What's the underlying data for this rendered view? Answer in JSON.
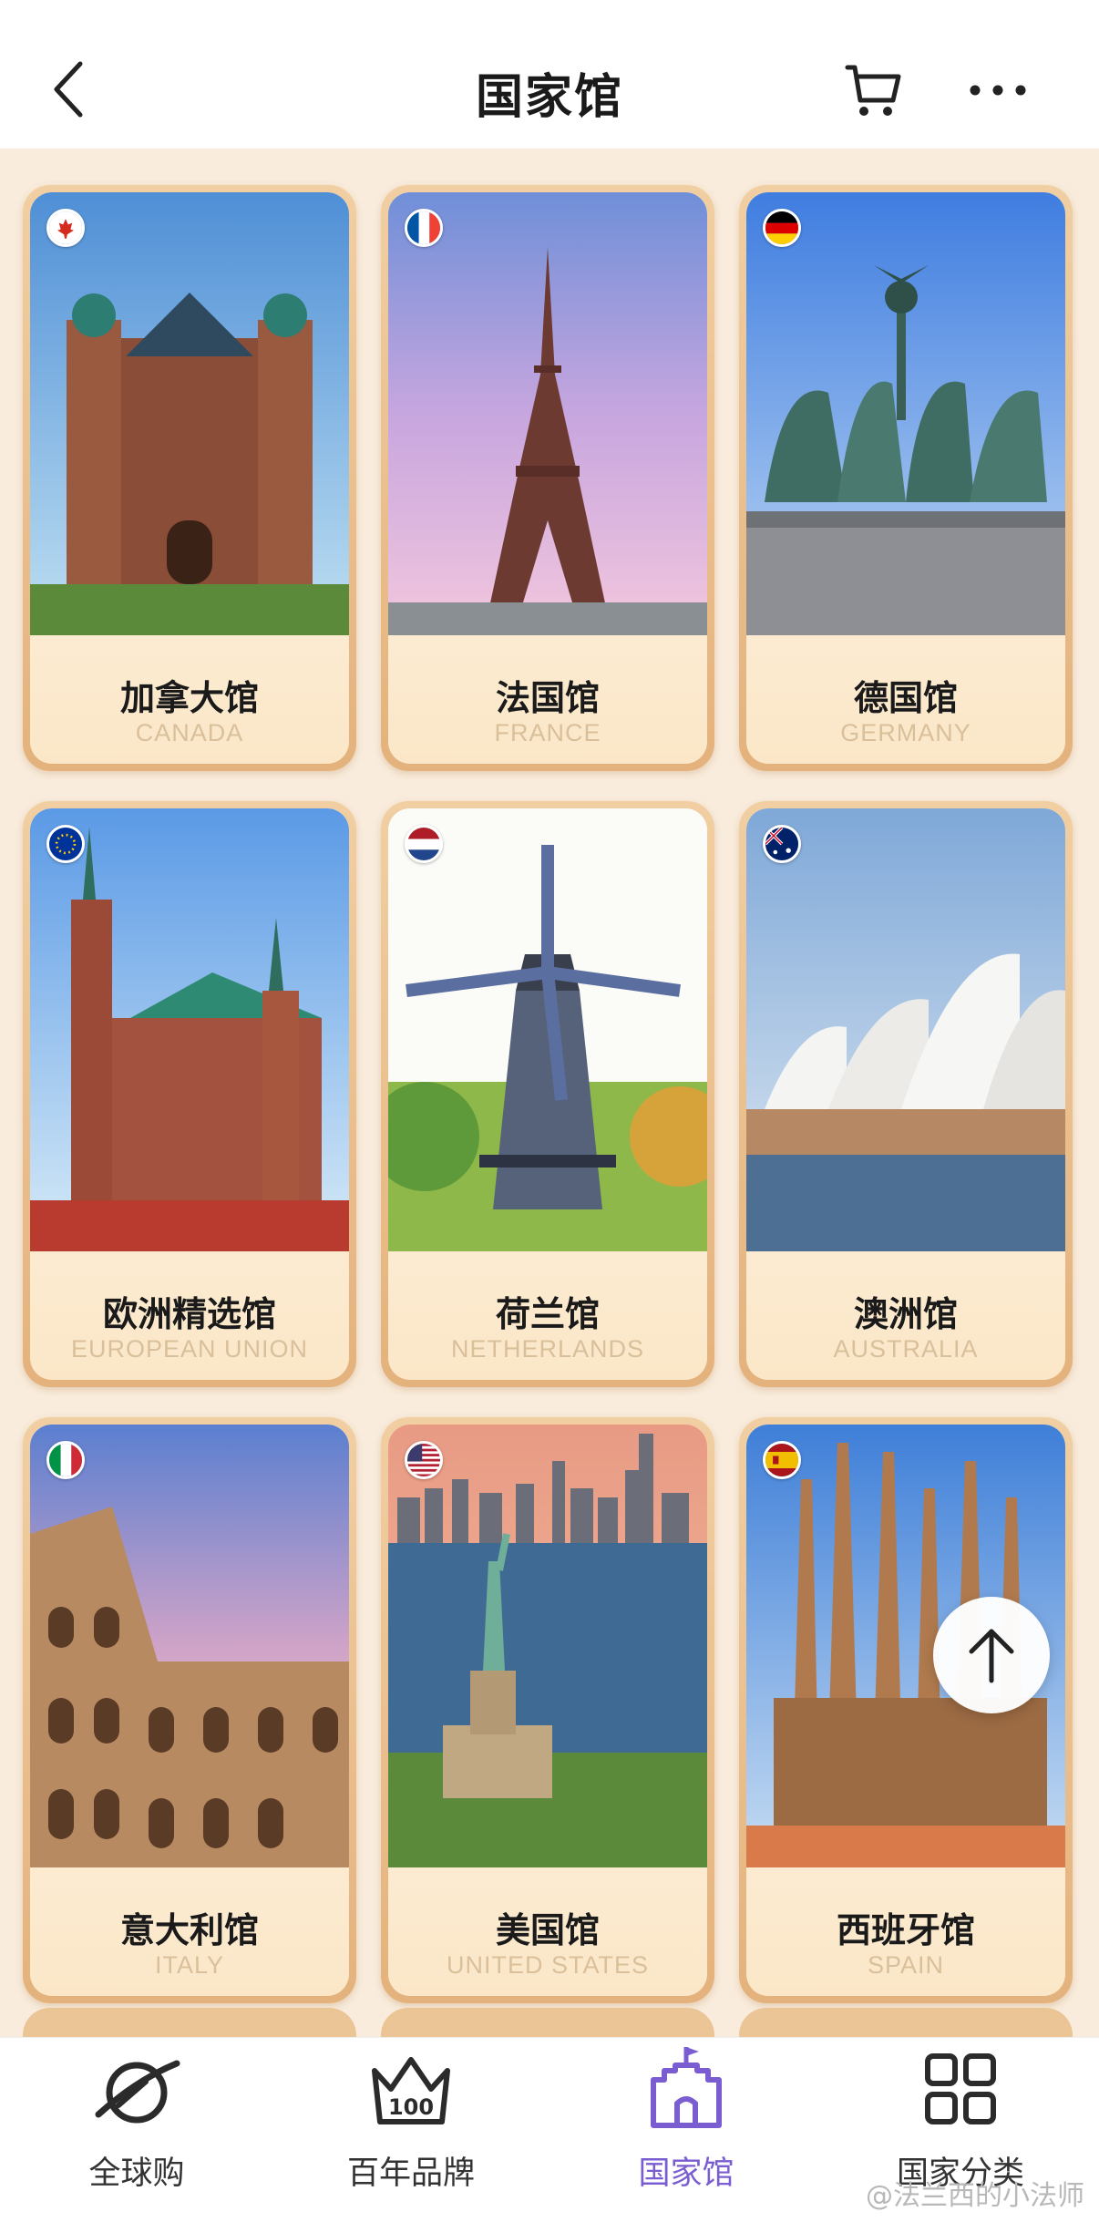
{
  "header": {
    "title": "国家馆",
    "back_icon": "chevron-left-icon",
    "cart_icon": "cart-icon",
    "more_icon": "more-dots-icon"
  },
  "pavilions": [
    {
      "name": "加拿大馆",
      "en": "CANADA",
      "flag": "canada-flag-icon"
    },
    {
      "name": "法国馆",
      "en": "FRANCE",
      "flag": "france-flag-icon"
    },
    {
      "name": "德国馆",
      "en": "GERMANY",
      "flag": "germany-flag-icon"
    },
    {
      "name": "欧洲精选馆",
      "en": "EUROPEAN UNION",
      "flag": "eu-flag-icon"
    },
    {
      "name": "荷兰馆",
      "en": "NETHERLANDS",
      "flag": "netherlands-flag-icon"
    },
    {
      "name": "澳洲馆",
      "en": "AUSTRALIA",
      "flag": "australia-flag-icon"
    },
    {
      "name": "意大利馆",
      "en": "ITALY",
      "flag": "italy-flag-icon"
    },
    {
      "name": "美国馆",
      "en": "UNITED STATES",
      "flag": "usa-flag-icon"
    },
    {
      "name": "西班牙馆",
      "en": "SPAIN",
      "flag": "spain-flag-icon"
    }
  ],
  "nav": [
    {
      "label": "全球购",
      "icon": "planet-icon",
      "active": false
    },
    {
      "label": "百年品牌",
      "icon": "crown-100-icon",
      "active": false
    },
    {
      "label": "国家馆",
      "icon": "castle-icon",
      "active": true
    },
    {
      "label": "国家分类",
      "icon": "grid-icon",
      "active": false
    }
  ],
  "colors": {
    "accent": "#7a5dd0",
    "page_bg": "#f9ecdc",
    "card_border": "#e4b27c",
    "english_subtitle": "#d9bf9a"
  },
  "watermark": "@法兰西的小法师"
}
